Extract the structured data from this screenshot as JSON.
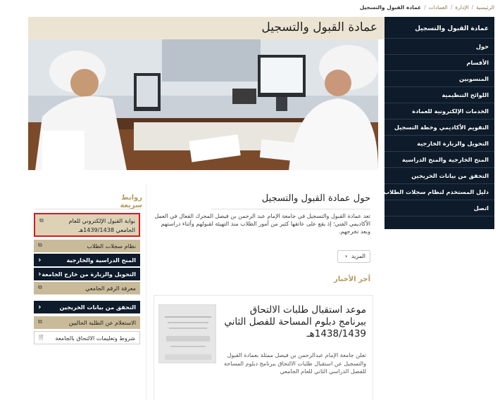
{
  "breadcrumb": {
    "home": "الرئيسية",
    "admin": "الإدارة",
    "deanships": "العمادات",
    "current": "عمادة القبول والتسجيل"
  },
  "sidebar": {
    "header": "عمادة القبول والتسجيل",
    "items": [
      "حول",
      "الأقسام",
      "المنسوبين",
      "اللوائح التنظيمية",
      "الخدمات الإلكترونية للعمادة",
      "التقويم الأكاديمي وخطة التسجيل",
      "التحويل والزيارة الخارجية",
      "المنح الخارجية والمنح الدراسية",
      "التحقق من بيانات الخريجين",
      "دليل المستخدم لنظام سجلات الطلاب",
      "اتصل"
    ]
  },
  "page_title": "عمادة القبول والتسجيل",
  "about": {
    "title": "حول عمادة القبول والتسجيل",
    "text": "تعد عمادة القبول والتسجيل في جامعة الإمام عبد الرحمن بن فيصل المحرك الفعال في العمل الأكاديمي الفني؛ إذ يقع على عاتقها كثير من أمور الطلاب منذ التهيئة لقبولهم وأثناء دراستهم وبعد تخرجهم.",
    "more_label": "المزيد"
  },
  "news": {
    "heading": "آخر الأخبار",
    "title": "موعد استقبال طلبات الالتحاق ببرنامج دبلوم المساحة للفصل الثاني 1438/1439هـ",
    "text": "تعلن جامعة الإمام عبدالرحمن بن فيصل ممثلة بعمادة القبول والتسجيل عن استقبال طلبات الالتحاق ببرنامج دبلوم المساحة للفصل الدراسي الثاني للعام الجامعي"
  },
  "quick_links": {
    "title": "روابط سريعة",
    "items": [
      {
        "line1": "بوابة القبول الإلكتروني للعام",
        "line2": "الجامعي 1439/1438هـ",
        "icon": "external-link-icon"
      },
      {
        "label": "نظام سجلات الطلاب",
        "icon": "external-link-icon"
      },
      {
        "label": "المنح الدراسية والخارجية",
        "icon": "chevron-left-icon"
      },
      {
        "label": "التحويل والزيارة من خارج الجامعة",
        "icon": "chevron-left-icon"
      },
      {
        "label": "معرفة الرقم الجامعي",
        "icon": "external-link-icon"
      },
      {
        "label": "التحقق من بيانات الخريجين",
        "icon": "chevron-left-icon"
      },
      {
        "label": "الاستعلام عن الطلبة الحاليين",
        "icon": "external-link-icon"
      },
      {
        "label": "شروط وتعليمات الالتحاق بالجامعة",
        "icon": "document-icon"
      }
    ]
  },
  "colors": {
    "navy": "#0d1b2a",
    "tan": "#c9bb99",
    "gold": "#b39a5c",
    "highlight": "#d71920"
  }
}
